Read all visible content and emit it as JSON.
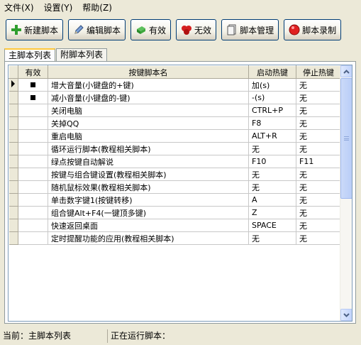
{
  "menu": [
    {
      "label": "文件(X)"
    },
    {
      "label": "设置(Y)"
    },
    {
      "label": "帮助(Z)"
    }
  ],
  "toolbar": {
    "new_script": "新建脚本",
    "edit_script": "编辑脚本",
    "enable": "有效",
    "disable": "无效",
    "manage": "脚本管理",
    "record": "脚本录制"
  },
  "tabs": {
    "main": "主脚本列表",
    "sub": "附脚本列表"
  },
  "grid": {
    "columns": [
      "有效",
      "按键脚本名",
      "启动热键",
      "停止热键"
    ],
    "rows": [
      {
        "name": "增大音量(小键盘的+键)",
        "start": "加(s)",
        "stop": "无"
      },
      {
        "name": "减小音量(小键盘的-键)",
        "start": "-(s)",
        "stop": "无"
      },
      {
        "name": "关闭电脑",
        "start": "CTRL+P",
        "stop": "无"
      },
      {
        "name": "关掉QQ",
        "start": "F8",
        "stop": "无"
      },
      {
        "name": "重启电脑",
        "start": "ALT+R",
        "stop": "无"
      },
      {
        "name": "循环运行脚本(教程相关脚本)",
        "start": "无",
        "stop": "无"
      },
      {
        "name": "绿点按键自动解说",
        "start": "F10",
        "stop": "F11"
      },
      {
        "name": "按键与组合键设置(教程相关脚本)",
        "start": "无",
        "stop": "无"
      },
      {
        "name": "随机鼠标效果(教程相关脚本)",
        "start": "无",
        "stop": "无"
      },
      {
        "name": "单击数字键1(按键转移)",
        "start": "A",
        "stop": "无"
      },
      {
        "name": "组合键Alt+F4(一键顶多键)",
        "start": "Z",
        "stop": "无"
      },
      {
        "name": "快速返回桌面",
        "start": "SPACE",
        "stop": "无"
      },
      {
        "name": "定时提醒功能的应用(教程相关脚本)",
        "start": "无",
        "stop": "无"
      }
    ]
  },
  "status": {
    "current": "当前：主脚本列表",
    "running": "正在运行脚本："
  }
}
